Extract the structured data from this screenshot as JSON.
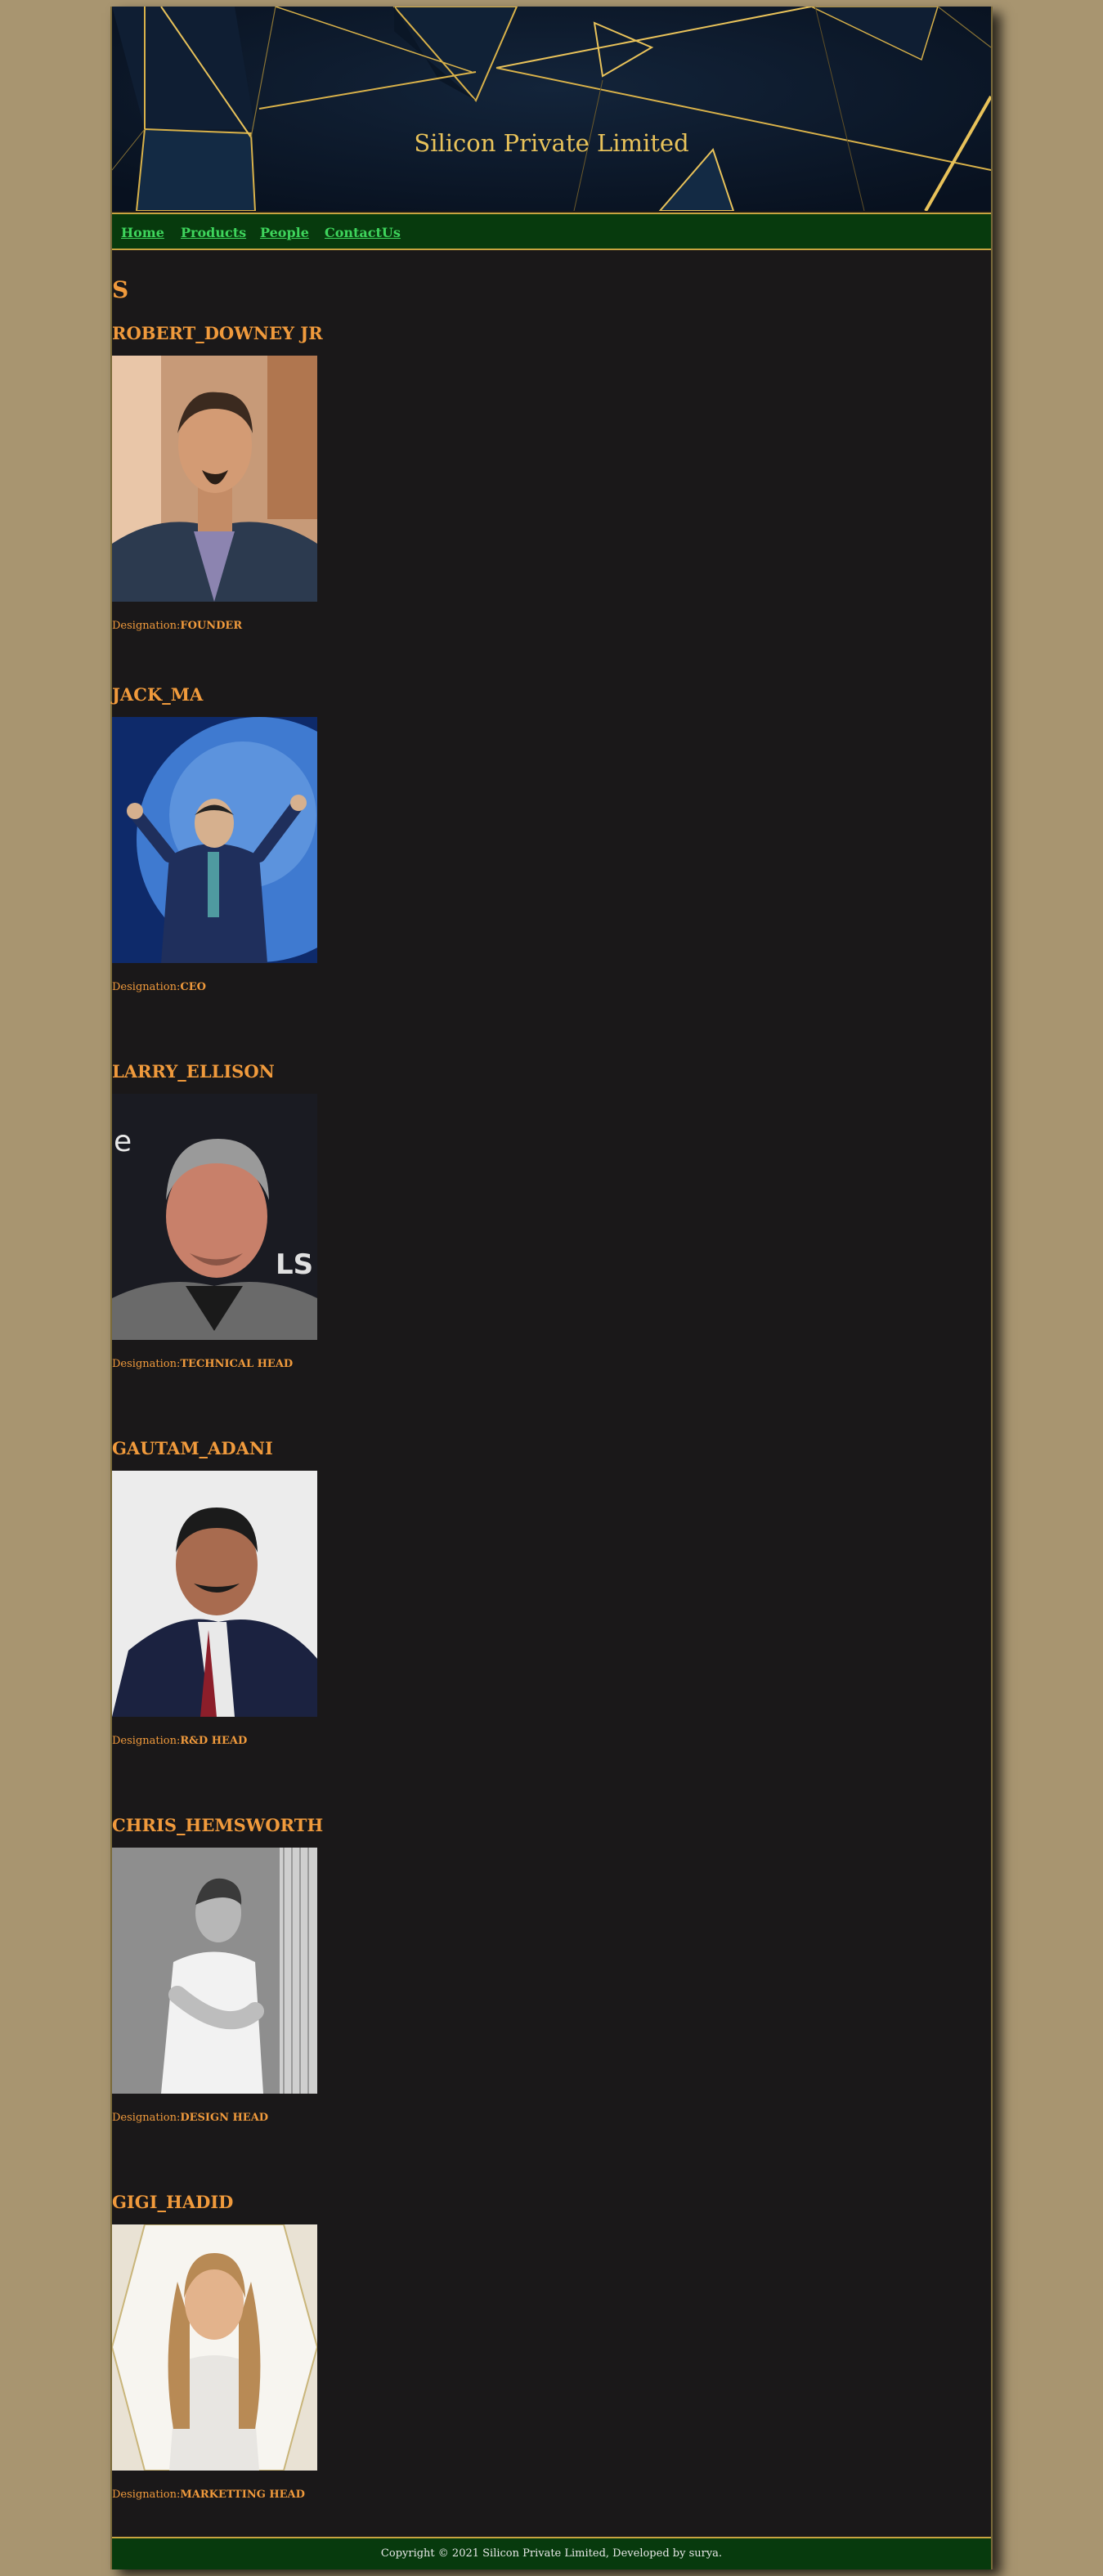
{
  "site": {
    "title": "Silicon Private Limited"
  },
  "nav": {
    "items": [
      {
        "label": "Home"
      },
      {
        "label": "Products"
      },
      {
        "label": "People"
      },
      {
        "label": "ContactUs"
      }
    ]
  },
  "section": {
    "letter": "S"
  },
  "people": [
    {
      "name": "ROBERT_DOWNEY JR",
      "designation_label": "Designation:",
      "designation": "FOUNDER"
    },
    {
      "name": "JACK_MA",
      "designation_label": "Designation:",
      "designation": "CEO"
    },
    {
      "name": "LARRY_ELLISON",
      "designation_label": "Designation:",
      "designation": "TECHNICAL HEAD"
    },
    {
      "name": "GAUTAM_ADANI",
      "designation_label": "Designation:",
      "designation": "R&D HEAD"
    },
    {
      "name": "CHRIS_HEMSWORTH",
      "designation_label": "Designation:",
      "designation": "DESIGN HEAD"
    },
    {
      "name": "GIGI_HADID",
      "designation_label": "Designation:",
      "designation": "MARKETTING HEAD"
    }
  ],
  "footer": {
    "text": "Copyright © 2021 Silicon Private Limited, Developed by surya."
  },
  "colors": {
    "page_background": "#a89570",
    "content_background": "#1a1819",
    "nav_background": "#073a0d",
    "nav_link": "#3ed45c",
    "heading_orange": "#f09a3c",
    "banner_gold": "#e8c25a",
    "banner_navy": "#0c1a2c"
  }
}
